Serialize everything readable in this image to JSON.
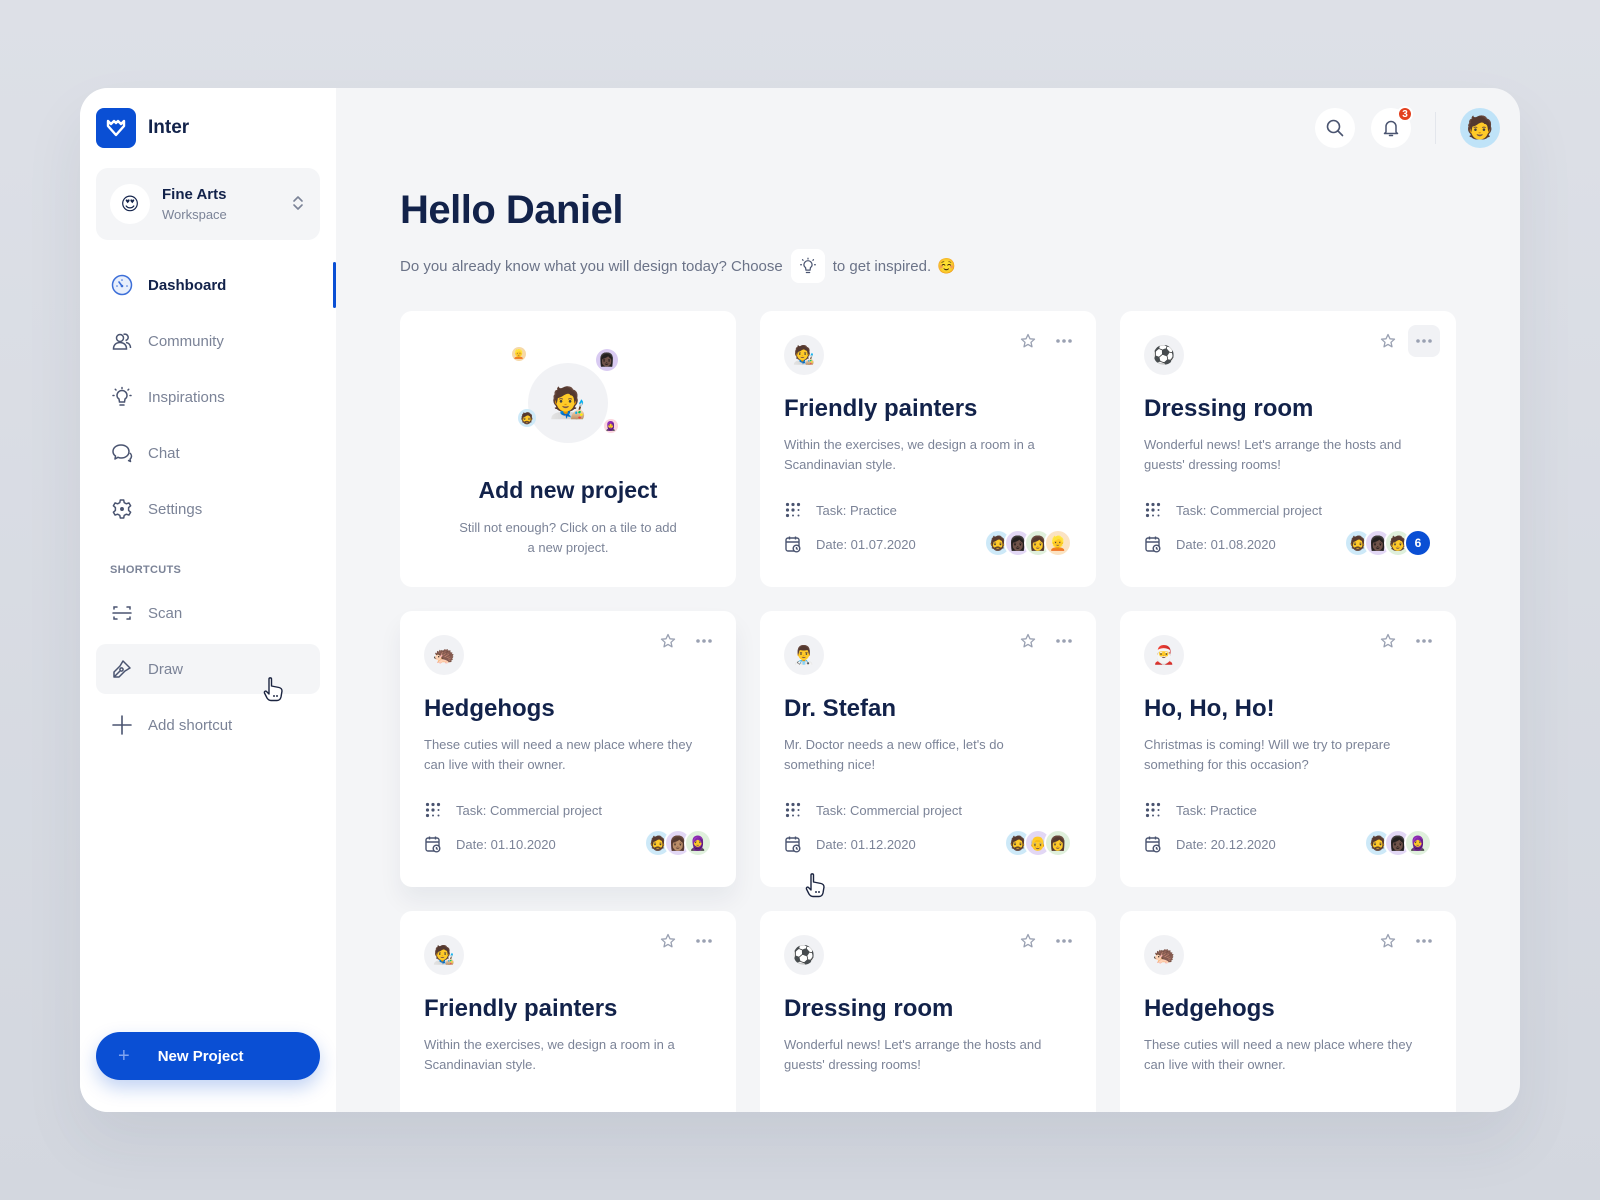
{
  "app": {
    "name": "Inter",
    "brand_color": "#0a4fd4"
  },
  "workspace": {
    "emoji": "😍",
    "name": "Fine Arts",
    "subtitle": "Workspace"
  },
  "sidebar": {
    "nav": [
      {
        "label": "Dashboard",
        "icon": "dashboard-icon",
        "active": true
      },
      {
        "label": "Community",
        "icon": "community-icon"
      },
      {
        "label": "Inspirations",
        "icon": "lightbulb-icon"
      },
      {
        "label": "Chat",
        "icon": "chat-icon"
      },
      {
        "label": "Settings",
        "icon": "gear-icon"
      }
    ],
    "shortcuts_label": "SHORTCUTS",
    "shortcuts": [
      {
        "label": "Scan",
        "icon": "scan-icon"
      },
      {
        "label": "Draw",
        "icon": "pen-icon",
        "hovered": true
      },
      {
        "label": "Add shortcut",
        "icon": "plus-icon"
      }
    ],
    "new_project_label": "New Project"
  },
  "topbar": {
    "notification_count": "3",
    "profile_emoji": "🧑"
  },
  "greeting": {
    "title": "Hello Daniel",
    "subtitle_before": "Do you already know what you will design today? Choose",
    "subtitle_after": "to get inspired.",
    "subtitle_emoji": "☺️"
  },
  "add_card": {
    "emoji": "🧑‍🎨",
    "title": "Add new project",
    "description": "Still not enough? Click on a tile to add a new project."
  },
  "projects": [
    {
      "emoji": "🧑‍🎨",
      "title": "Friendly painters",
      "description": "Within the exercises, we design a room in a Scandinavian style.",
      "task": "Task: Practice",
      "date": "Date: 01.07.2020",
      "members": [
        "🧔",
        "👩🏿",
        "👩",
        "👱"
      ],
      "extra": ""
    },
    {
      "emoji": "⚽",
      "title": "Dressing room",
      "description": "Wonderful news! Let's arrange the hosts and guests' dressing rooms!",
      "task": "Task: Commercial project",
      "date": "Date: 01.08.2020",
      "members": [
        "🧔",
        "👩🏿",
        "🧑"
      ],
      "extra": "6"
    },
    {
      "emoji": "🦔",
      "title": "Hedgehogs",
      "description": "These cuties will need a new place where they can live with their owner.",
      "task": "Task: Commercial project",
      "date": "Date: 01.10.2020",
      "members": [
        "🧔",
        "👩🏽",
        "🧕"
      ],
      "extra": ""
    },
    {
      "emoji": "👨‍⚕️",
      "title": "Dr. Stefan",
      "description": "Mr. Doctor needs a new office, let's do something nice!",
      "task": "Task: Commercial project",
      "date": "Date: 01.12.2020",
      "members": [
        "🧔",
        "👴",
        "👩"
      ],
      "extra": ""
    },
    {
      "emoji": "🎅",
      "title": "Ho, Ho, Ho!",
      "description": "Christmas is coming! Will we try to prepare something for this occasion?",
      "task": "Task: Practice",
      "date": "Date: 20.12.2020",
      "members": [
        "🧔",
        "👩🏿",
        "🧕"
      ],
      "extra": ""
    },
    {
      "emoji": "🧑‍🎨",
      "title": "Friendly painters",
      "description": "Within the exercises, we design a room in a Scandinavian style.",
      "task": "",
      "date": "",
      "members": [],
      "extra": ""
    },
    {
      "emoji": "⚽",
      "title": "Dressing room",
      "description": "Wonderful news! Let's arrange the hosts and guests' dressing rooms!",
      "task": "",
      "date": "",
      "members": [],
      "extra": ""
    },
    {
      "emoji": "🦔",
      "title": "Hedgehogs",
      "description": "These cuties will need a new place where they can live with their owner.",
      "task": "",
      "date": "",
      "members": [],
      "extra": ""
    }
  ]
}
